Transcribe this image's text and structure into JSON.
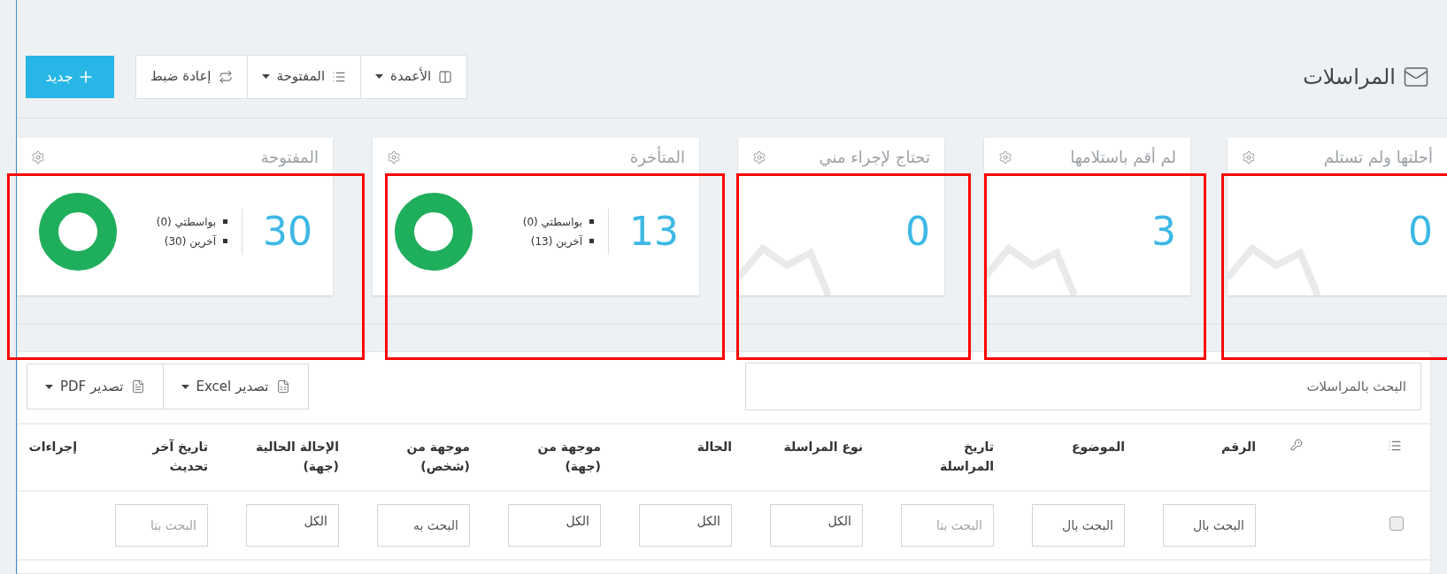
{
  "page": {
    "title": "المراسلات"
  },
  "toolbar": {
    "new_button": "جديد",
    "buttons": [
      {
        "label": "الأعمدة",
        "dropdown": true
      },
      {
        "label": "المفتوحة",
        "dropdown": true
      },
      {
        "label": "إعادة ضبط",
        "dropdown": false
      }
    ]
  },
  "cards": [
    {
      "title": "أحلتها ولم تستلم",
      "value": "0",
      "kind": "sparkline",
      "highlighted": true
    },
    {
      "title": "لم أقم باستلامها",
      "value": "3",
      "kind": "sparkline",
      "highlighted": true
    },
    {
      "title": "تحتاج لإجراء مني",
      "value": "0",
      "kind": "sparkline",
      "highlighted": true
    },
    {
      "title": "المتأخرة",
      "value": "13",
      "kind": "donut",
      "items": [
        "بواسطتي (0)",
        "آخرين (13)"
      ],
      "highlighted": true
    },
    {
      "title": "المفتوحة",
      "value": "30",
      "kind": "donut",
      "items": [
        "بواسطتي (0)",
        "آخرين (30)"
      ],
      "highlighted": true
    }
  ],
  "search": {
    "placeholder": "البحث بالمراسلات"
  },
  "export_buttons": [
    {
      "label": "تصدير Excel"
    },
    {
      "label": "تصدير PDF"
    }
  ],
  "table": {
    "columns": [
      {
        "kind": "menu",
        "filter": {
          "kind": "checkbox",
          "checked": false
        }
      },
      {
        "kind": "key"
      },
      {
        "kind": "text",
        "header": "الرقم",
        "filter": {
          "kind": "text",
          "placeholder": "البحث بال"
        }
      },
      {
        "kind": "text",
        "header": "الموضوع",
        "filter": {
          "kind": "text",
          "placeholder": "البحث بال"
        }
      },
      {
        "kind": "text",
        "header": "تاريخ\nالمراسلة",
        "filter": {
          "kind": "date",
          "placeholder": "البحث بتا"
        }
      },
      {
        "kind": "text",
        "header": "نوع المراسلة",
        "filter": {
          "kind": "select",
          "value": "الكل"
        }
      },
      {
        "kind": "text",
        "header": "الحالة",
        "filter": {
          "kind": "select",
          "value": "الكل"
        }
      },
      {
        "kind": "text",
        "header": "موجهة من\n(جهة)",
        "filter": {
          "kind": "select",
          "value": "الكل"
        }
      },
      {
        "kind": "text",
        "header": "موجهة من\n(شخص)",
        "filter": {
          "kind": "text",
          "placeholder": "البحث به"
        }
      },
      {
        "kind": "text",
        "header": "الإحالة الحالية\n(جهة)",
        "filter": {
          "kind": "select",
          "value": "الكل"
        }
      },
      {
        "kind": "text",
        "header": "تاريخ آخر\nتحديث",
        "filter": {
          "kind": "date",
          "placeholder": "البحث بتا"
        }
      },
      {
        "kind": "text",
        "header": "إجراءات"
      }
    ]
  }
}
